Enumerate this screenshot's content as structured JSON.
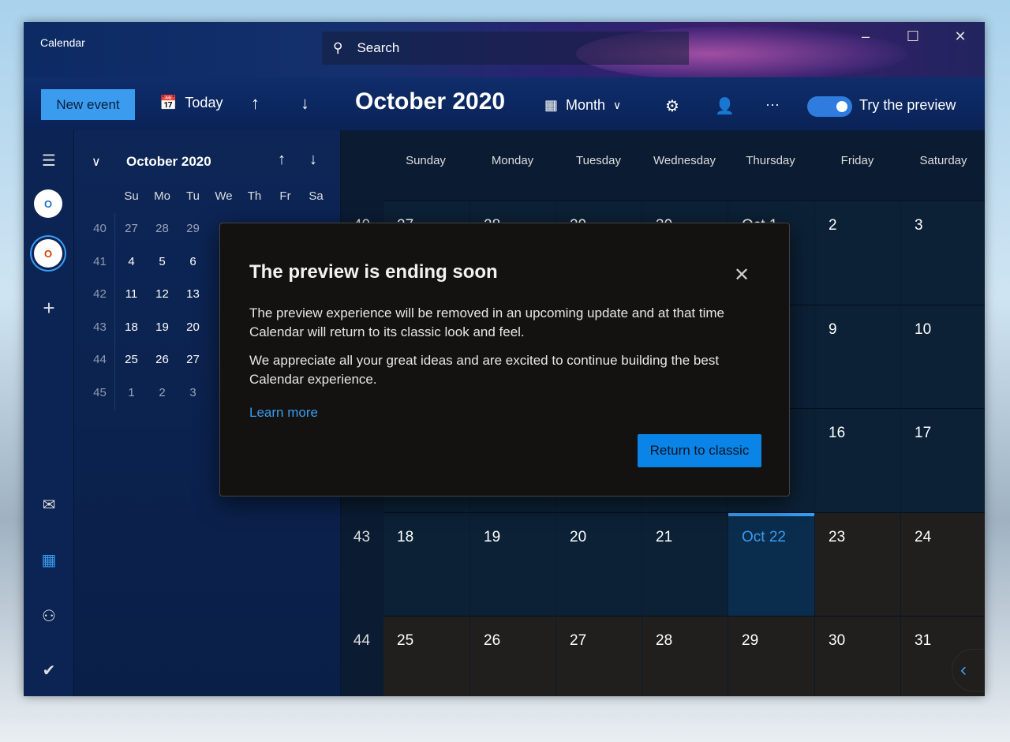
{
  "app": {
    "title": "Calendar"
  },
  "search": {
    "placeholder": "Search",
    "icon": "search-icon"
  },
  "window_controls": {
    "minimize": "–",
    "maximize": "☐",
    "close": "✕"
  },
  "toolbar": {
    "new_event": "New event",
    "today": "Today",
    "title": "October 2020",
    "view": "Month",
    "preview_label": "Try the preview",
    "preview_on": true,
    "more": "···"
  },
  "rail": {
    "items": [
      "menu-icon",
      "outlook-account",
      "office-account",
      "add-account",
      "mail-icon",
      "calendar-icon",
      "people-icon",
      "todo-icon"
    ]
  },
  "mini_calendar": {
    "title": "October 2020",
    "weekdays": [
      "Su",
      "Mo",
      "Tu",
      "We",
      "Th",
      "Fr",
      "Sa"
    ],
    "weeks": [
      {
        "num": "40",
        "days": [
          "27",
          "28",
          "29"
        ],
        "dim": true
      },
      {
        "num": "41",
        "days": [
          "4",
          "5",
          "6"
        ]
      },
      {
        "num": "42",
        "days": [
          "11",
          "12",
          "13"
        ]
      },
      {
        "num": "43",
        "days": [
          "18",
          "19",
          "20"
        ]
      },
      {
        "num": "44",
        "days": [
          "25",
          "26",
          "27"
        ]
      },
      {
        "num": "45",
        "days": [
          "1",
          "2",
          "3"
        ],
        "dim": true
      }
    ]
  },
  "month_grid": {
    "weekdays": [
      "Sunday",
      "Monday",
      "Tuesday",
      "Wednesday",
      "Thursday",
      "Friday",
      "Saturday"
    ],
    "today": "Oct 22",
    "rows": [
      {
        "week": "40",
        "days": [
          "27",
          "28",
          "29",
          "30",
          "Oct 1",
          "2",
          "3"
        ]
      },
      {
        "week": "",
        "days": [
          "",
          "",
          "",
          "",
          "",
          "9",
          "10"
        ]
      },
      {
        "week": "",
        "days": [
          "",
          "",
          "",
          "",
          "",
          "16",
          "17"
        ]
      },
      {
        "week": "43",
        "days": [
          "18",
          "19",
          "20",
          "21",
          "Oct 22",
          "23",
          "24"
        ]
      },
      {
        "week": "44",
        "days": [
          "25",
          "26",
          "27",
          "28",
          "29",
          "30",
          "31"
        ]
      }
    ]
  },
  "dialog": {
    "title": "The preview is ending soon",
    "body1": "The preview experience will be removed in an upcoming update and at that time Calendar will return to its classic look and feel.",
    "body2": "We appreciate all your great ideas and are excited to continue building the best Calendar experience.",
    "link": "Learn more",
    "button": "Return to classic",
    "close": "✕"
  },
  "colors": {
    "accent": "#3a9bef",
    "button": "#0a84e6",
    "past_cell": "#0c2136",
    "future_cell": "#201f1e",
    "today_cell": "#0b2d4d"
  }
}
